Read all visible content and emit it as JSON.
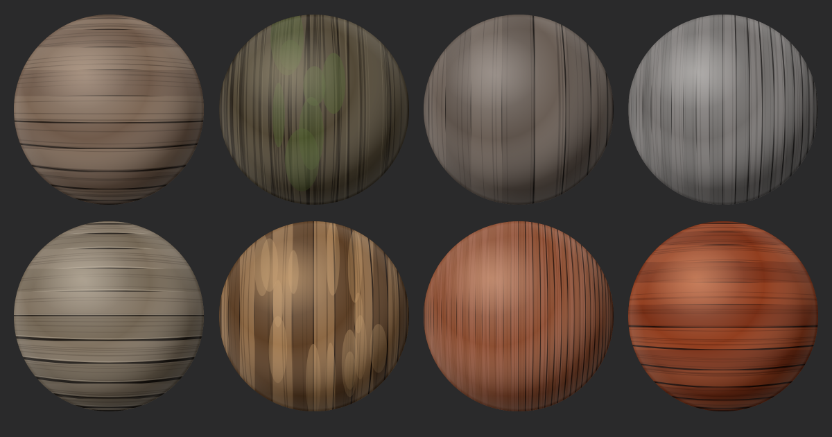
{
  "background": "#2a2a2b",
  "materials": [
    {
      "name": "weathered-horizontal-planks",
      "plank_orientation": "horizontal",
      "plank_count": 11,
      "base_color": "#6d5747",
      "alt_color": "#7b6553",
      "seam_color": "#1e1610",
      "grain_color": "#4e3d31",
      "highlight": "#b59c86",
      "layered_rims": false,
      "bark": false
    },
    {
      "name": "mossy-tree-bark",
      "plank_orientation": "none",
      "plank_count": 0,
      "base_color": "#4f4533",
      "alt_color": "#5d5340",
      "seam_color": "#1c170f",
      "grain_color": "#2c2519",
      "highlight": "#8a8063",
      "moss_color": "#4d5a2b",
      "layered_rims": false,
      "bark": true
    },
    {
      "name": "gray-vertical-weathered-wood",
      "plank_orientation": "vertical",
      "plank_count": 9,
      "base_color": "#5b5048",
      "alt_color": "#675b52",
      "seam_color": "#1b1714",
      "grain_color": "#3c342e",
      "highlight": "#a19790",
      "layered_rims": false,
      "bark": false
    },
    {
      "name": "gray-vertical-planks",
      "plank_orientation": "vertical",
      "plank_count": 22,
      "base_color": "#6d6a68",
      "alt_color": "#787472",
      "seam_color": "#262423",
      "grain_color": "#55514f",
      "highlight": "#bdbab7",
      "layered_rims": false,
      "bark": false
    },
    {
      "name": "stacked-horizontal-boards",
      "plank_orientation": "horizontal",
      "plank_count": 12,
      "base_color": "#726553",
      "alt_color": "#7e705e",
      "seam_color": "#1b1611",
      "grain_color": "#574b3d",
      "highlight": "#bfb29e",
      "layered_rims": true,
      "bark": false
    },
    {
      "name": "worn-painted-vertical-planks",
      "plank_orientation": "vertical",
      "plank_count": 14,
      "base_color": "#5a3c22",
      "alt_color": "#8a6540",
      "seam_color": "#1e120a",
      "grain_color": "#3e2815",
      "highlight": "#c79a66",
      "layered_rims": false,
      "bark": false
    },
    {
      "name": "thin-vertical-strips",
      "plank_orientation": "vertical",
      "plank_count": 40,
      "base_color": "#8a4b2e",
      "alt_color": "#94543a",
      "seam_color": "#2a140b",
      "grain_color": "#7a3f24",
      "highlight": "#d09472",
      "layered_rims": false,
      "bark": false
    },
    {
      "name": "varnished-red-horizontal-planks",
      "plank_orientation": "horizontal",
      "plank_count": 13,
      "base_color": "#7a2e14",
      "alt_color": "#8f3a1a",
      "seam_color": "#1e0a04",
      "grain_color": "#5c1f0c",
      "highlight": "#e08a5c",
      "layered_rims": false,
      "bark": false
    }
  ]
}
